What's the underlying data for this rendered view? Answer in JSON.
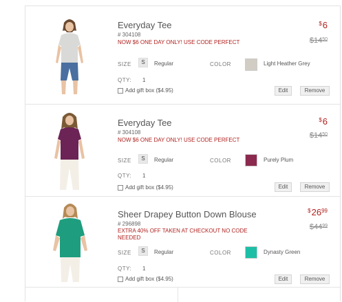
{
  "items": [
    {
      "name": "Everyday Tee",
      "sku": "# 304108",
      "promo": "NOW $6 ONE DAY ONLY! USE CODE PERFECT",
      "size_label": "SIZE",
      "size": "S",
      "fit": "Regular",
      "color_label": "COLOR",
      "color_name": "Light Heather Grey",
      "swatch_color": "#d1cdc4",
      "qty_label": "QTY:",
      "qty": "1",
      "gift_label": "Add gift box ($4.95)",
      "edit_label": "Edit",
      "remove_label": "Remove",
      "price_currency": "$",
      "price_main": "6",
      "price_cents": "",
      "old_price_main": "$14",
      "old_price_cents": "50",
      "shirt_color": "#d9d9d7"
    },
    {
      "name": "Everyday Tee",
      "sku": "# 304108",
      "promo": "NOW $6 ONE DAY ONLY! USE CODE PERFECT",
      "size_label": "SIZE",
      "size": "S",
      "fit": "Regular",
      "color_label": "COLOR",
      "color_name": "Purely Plum",
      "swatch_color": "#8b2a4e",
      "qty_label": "QTY:",
      "qty": "1",
      "gift_label": "Add gift box ($4.95)",
      "edit_label": "Edit",
      "remove_label": "Remove",
      "price_currency": "$",
      "price_main": "6",
      "price_cents": "",
      "old_price_main": "$14",
      "old_price_cents": "50",
      "shirt_color": "#6b2455"
    },
    {
      "name": "Sheer Drapey Button Down Blouse",
      "sku": "# 296898",
      "promo": "EXTRA 40% OFF TAKEN AT CHECKOUT NO CODE NEEDED",
      "size_label": "SIZE",
      "size": "S",
      "fit": "Regular",
      "color_label": "COLOR",
      "color_name": "Dynasty Green",
      "swatch_color": "#1cbfa5",
      "qty_label": "QTY:",
      "qty": "1",
      "gift_label": "Add gift box ($4.95)",
      "edit_label": "Edit",
      "remove_label": "Remove",
      "price_currency": "$",
      "price_main": "26",
      "price_cents": "99",
      "old_price_main": "$44",
      "old_price_cents": "99",
      "shirt_color": "#1e9e7e"
    }
  ]
}
